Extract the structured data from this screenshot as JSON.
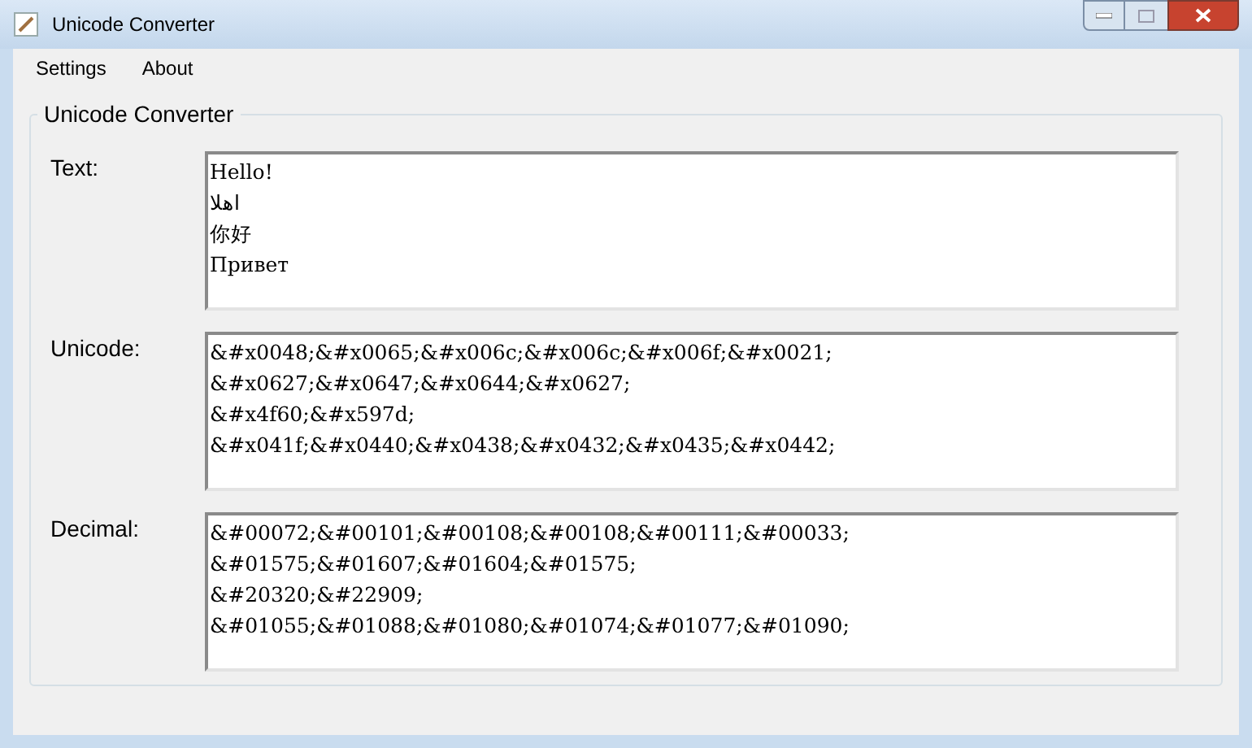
{
  "window": {
    "title": "Unicode Converter"
  },
  "menu": [
    "Settings",
    "About"
  ],
  "group": {
    "title": "Unicode Converter",
    "fields": [
      {
        "label": "Text:",
        "lines": [
          "Hello!",
          "اهلا",
          "你好",
          "Привет"
        ]
      },
      {
        "label": "Unicode:",
        "lines": [
          "&#x0048;&#x0065;&#x006c;&#x006c;&#x006f;&#x0021;",
          "&#x0627;&#x0647;&#x0644;&#x0627;",
          "&#x4f60;&#x597d;",
          "&#x041f;&#x0440;&#x0438;&#x0432;&#x0435;&#x0442;"
        ]
      },
      {
        "label": "Decimal:",
        "lines": [
          "&#00072;&#00101;&#00108;&#00108;&#00111;&#00033;",
          "&#01575;&#01607;&#01604;&#01575;",
          "&#20320;&#22909;",
          "&#01055;&#01088;&#01080;&#01074;&#01077;&#01090;"
        ]
      }
    ]
  }
}
